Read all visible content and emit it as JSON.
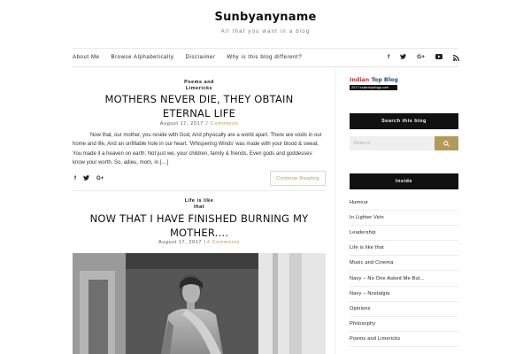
{
  "site": {
    "title": "Sunbyanyname",
    "tagline": "All that you want in a blog"
  },
  "nav": {
    "links": [
      "About Me",
      "Browse Alphabetically",
      "Disclaimer",
      "Why is this blog different?"
    ],
    "icons": [
      "facebook-icon",
      "twitter-icon",
      "google-plus-icon",
      "youtube-icon",
      "rss-icon"
    ],
    "icon_glyphs": [
      "f",
      "t",
      "G+",
      "▶",
      ""
    ]
  },
  "posts": [
    {
      "category": [
        "Poems and",
        "Limericks"
      ],
      "title": [
        "MOTHERS NEVER DIE, THEY OBTAIN",
        "ETERNAL LIFE"
      ],
      "date": "August 17, 2017",
      "comments": "2 Comments",
      "excerpt": "Now that, our mother, you reside with God, And physically are a world apart. There are voids in our home and life, And an unfillable hole in our heart. 'Whispering Winds' was made with your blood & sweat, You made it a heaven on earth; Not just we, your children, family & friends, Even gods and goddesses know your worth. So, adieu, mom, in […]",
      "continue_label": "Continue Reading"
    },
    {
      "category": [
        "Life is like",
        "that"
      ],
      "title": [
        "NOW THAT I HAVE FINISHED BURNING MY",
        "MOTHER...."
      ],
      "date": "August 17, 2017",
      "comments": "14 Comments"
    }
  ],
  "share_glyphs": [
    "f",
    "t",
    "G+"
  ],
  "sidebar": {
    "badge": {
      "word1": "Indian",
      "word2": "Top Blog",
      "subtitle": "2017 indiantopblogs.com"
    },
    "search": {
      "heading": "Search this blog",
      "placeholder": "Search"
    },
    "inside": {
      "heading": "Inside",
      "items": [
        "Humour",
        "In Lighter Vein",
        "Leadership",
        "Life is like that",
        "Music and Cinema",
        "Navy – No One Asked Me But...",
        "Navy – Nostalgia",
        "Opinions",
        "Philosophy",
        "Poems and Limericks"
      ]
    }
  },
  "colors": {
    "accent": "#b49a58",
    "dark": "#111111"
  }
}
